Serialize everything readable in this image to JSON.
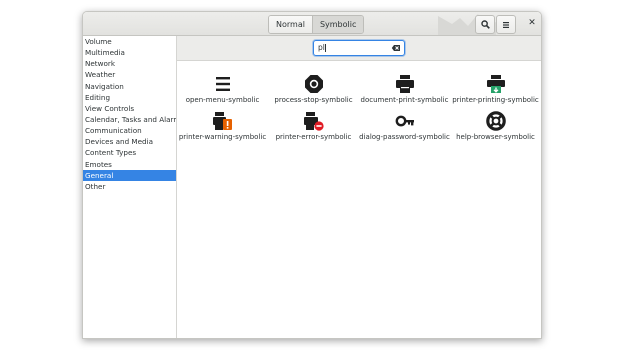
{
  "header": {
    "segments": [
      "Normal",
      "Symbolic"
    ],
    "active_segment": "Symbolic",
    "search_icon": "search-icon",
    "menu_icon": "hamburger-menu-icon",
    "close_label": "✕"
  },
  "sidebar": {
    "items": [
      {
        "label": "Volume"
      },
      {
        "label": "Multimedia"
      },
      {
        "label": "Network"
      },
      {
        "label": "Weather"
      },
      {
        "label": "Navigation"
      },
      {
        "label": "Editing"
      },
      {
        "label": "View Controls"
      },
      {
        "label": "Calendar, Tasks and Alarms"
      },
      {
        "label": "Communication"
      },
      {
        "label": "Devices and Media"
      },
      {
        "label": "Content Types"
      },
      {
        "label": "Emotes"
      },
      {
        "label": "General",
        "selected": true
      },
      {
        "label": "Other"
      }
    ]
  },
  "search": {
    "value": "pl"
  },
  "icons": [
    {
      "label": "open-menu-symbolic",
      "icon": "open-menu-icon"
    },
    {
      "label": "process-stop-symbolic",
      "icon": "process-stop-icon"
    },
    {
      "label": "document-print-symbolic",
      "icon": "printer-icon"
    },
    {
      "label": "printer-printing-symbolic",
      "icon": "printer-printing-icon"
    },
    {
      "label": "printer-warning-symbolic",
      "icon": "printer-warning-icon"
    },
    {
      "label": "printer-error-symbolic",
      "icon": "printer-error-icon"
    },
    {
      "label": "dialog-password-symbolic",
      "icon": "key-icon"
    },
    {
      "label": "help-browser-symbolic",
      "icon": "lifebuoy-icon"
    }
  ],
  "colors": {
    "selection": "#3584e4",
    "accent_green": "#26a269",
    "warning_orange": "#e66100",
    "error_red": "#e01b24"
  }
}
